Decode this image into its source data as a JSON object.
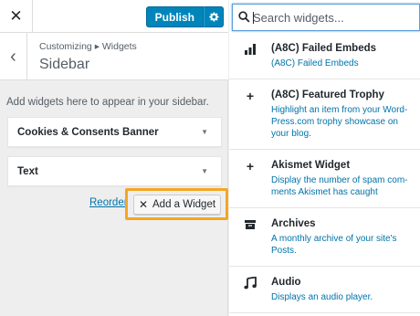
{
  "topbar": {
    "close_glyph": "✕",
    "publish_label": "Publish",
    "settings_icon": "gear-icon"
  },
  "section": {
    "breadcrumb": "Customizing ▸ Widgets",
    "title": "Sidebar",
    "back_glyph": "‹"
  },
  "sidebar": {
    "description": "Add widgets here to appear in your sidebar.",
    "widgets": [
      {
        "label": "Cookies & Consents Banner"
      },
      {
        "label": "Text"
      }
    ],
    "reorder_label": "Reorder",
    "add_widget_label": "Add a Widget"
  },
  "search": {
    "placeholder": "Search widgets..."
  },
  "available_widgets": [
    {
      "icon": "bar-chart-icon",
      "title": "(A8C) Failed Embeds",
      "desc": "(A8C) Failed Embeds"
    },
    {
      "icon": "plus-icon",
      "title": "(A8C) Featured Trophy",
      "desc": "Highlight an item from your Word-Press.com trophy showcase on your blog."
    },
    {
      "icon": "plus-icon",
      "title": "Akismet Widget",
      "desc": "Display the number of spam com-ments Akismet has caught"
    },
    {
      "icon": "archive-icon",
      "title": "Archives",
      "desc": "A monthly archive of your site's Posts."
    },
    {
      "icon": "music-note-icon",
      "title": "Audio",
      "desc": "Displays an audio player."
    }
  ],
  "colors": {
    "accent": "#0085ba",
    "highlight": "#f5a623",
    "link": "#0073aa"
  }
}
